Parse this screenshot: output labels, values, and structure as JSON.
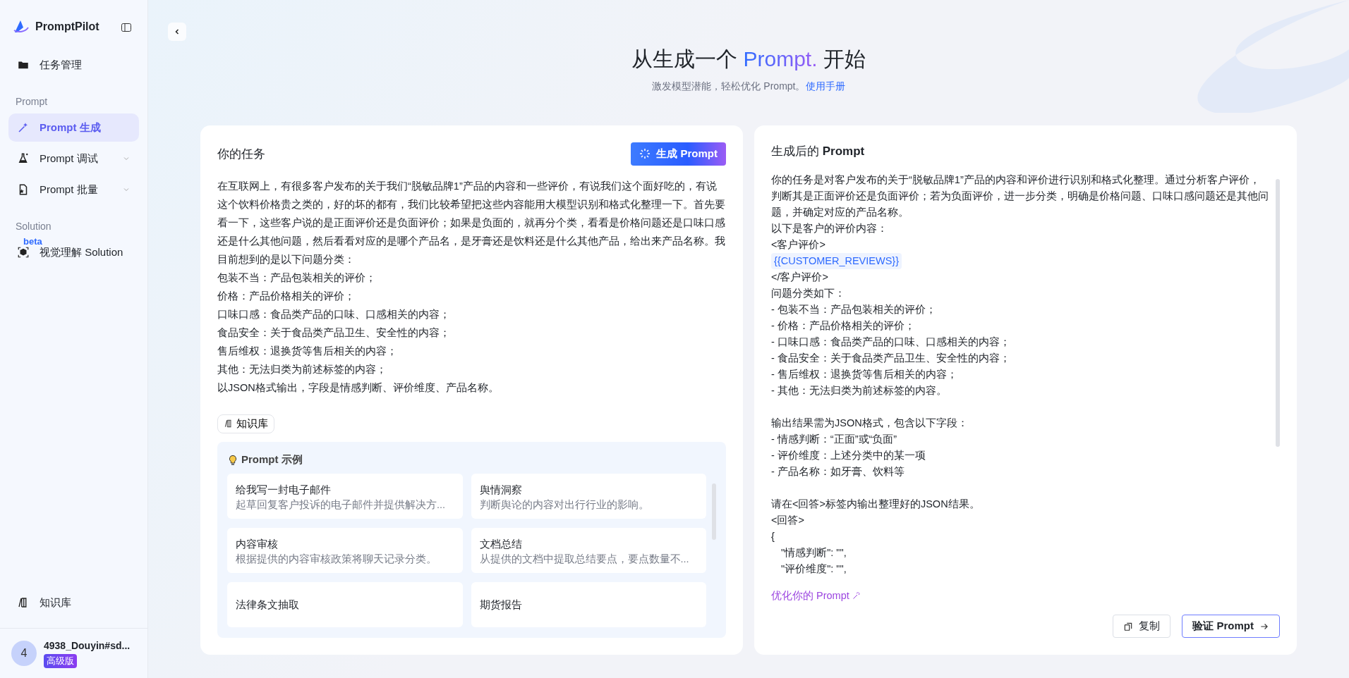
{
  "sidebar": {
    "brand": "PromptPilot",
    "items": [
      {
        "kind": "nav",
        "label": "任务管理",
        "selected": false
      },
      {
        "kind": "section",
        "label": "Prompt"
      },
      {
        "kind": "nav",
        "label": "Prompt 生成",
        "selected": true
      },
      {
        "kind": "nav",
        "label": "Prompt 调试",
        "selected": false,
        "expanded": false
      },
      {
        "kind": "nav",
        "label": "Prompt 批量",
        "selected": false,
        "expanded": false
      },
      {
        "kind": "section",
        "label": "Solution"
      },
      {
        "kind": "nav",
        "label": "视觉理解 Solution",
        "selected": false,
        "badge": "beta"
      }
    ],
    "bottom_item": {
      "label": "知识库"
    },
    "user": {
      "avatar": "4",
      "name": "4938_Douyin#sd...",
      "plan": "高级版"
    }
  },
  "header": {
    "title_start": "从生成一个 ",
    "title_highlight": "Prompt.",
    "title_end": " 开始",
    "subtitle": "激发模型潜能，轻松优化 Prompt。",
    "manual_link": "使用手册"
  },
  "task_card": {
    "title": "你的任务",
    "generate_button": "生成 Prompt",
    "lines": [
      "在互联网上，有很多客户发布的关于我们“脱敏品牌1”产品的内容和一些评价，有说我们这个面好吃的，有说这个饮料价格贵之类的，好的坏的都有，我们比较希望把这些内容能用大模型识别和格式化整理一下。首先要看一下，这些客户说的是正面评价还是负面评价；如果是负面的，就再分个类，看看是价格问题还是口味口感还是什么其他问题，然后看看对应的是哪个产品名，是牙膏还是饮料还是什么其他产品，给出来产品名称。我目前想到的是以下问题分类：",
      "包装不当：产品包装相关的评价；",
      "价格：产品价格相关的评价；",
      "口味口感：食品类产品的口味、口感相关的内容；",
      "食品安全：关于食品类产品卫生、安全性的内容；",
      "售后维权：退换货等售后相关的内容；",
      "其他：无法归类为前述标签的内容；",
      "以JSON格式输出，字段是情感判断、评价维度、产品名称。"
    ],
    "knowledge_chip": "知识库",
    "examples_title": "Prompt 示例",
    "examples": [
      {
        "title": "给我写一封电子邮件",
        "desc": "起草回复客户投诉的电子邮件并提供解决方..."
      },
      {
        "title": "舆情洞察",
        "desc": "判断舆论的内容对出行行业的影响。"
      },
      {
        "title": "内容审核",
        "desc": "根据提供的内容审核政策将聊天记录分类。"
      },
      {
        "title": "文档总结",
        "desc": "从提供的文档中提取总结要点，要点数量不..."
      },
      {
        "title": "法律条文抽取"
      },
      {
        "title": "期货报告"
      }
    ]
  },
  "result_card": {
    "title_start": "生成后的 ",
    "title_bold": "Prompt",
    "blocks": [
      [
        {
          "kind": "text",
          "text": "你的任务是对客户发布的关于“脱敏品牌1”产品的内容和评价进行识别和格式化整理。通过分析客户评价，判断其是正面评价还是负面评价；若为负面评价，进一步分类，明确是价格问题、口味口感问题还是其他问题，并确定对应的产品名称。"
        },
        {
          "kind": "text",
          "text": "以下是客户的评价内容："
        },
        {
          "kind": "text",
          "text": "<客户评价>"
        },
        {
          "kind": "variable",
          "text": "{{CUSTOMER_REVIEWS}}"
        },
        {
          "kind": "text",
          "text": "</客户评价>"
        },
        {
          "kind": "text",
          "text": "问题分类如下："
        },
        {
          "kind": "text",
          "text": "- 包装不当：产品包装相关的评价；"
        },
        {
          "kind": "text",
          "text": "- 价格：产品价格相关的评价；"
        },
        {
          "kind": "text",
          "text": "- 口味口感：食品类产品的口味、口感相关的内容；"
        },
        {
          "kind": "text",
          "text": "- 食品安全：关于食品类产品卫生、安全性的内容；"
        },
        {
          "kind": "text",
          "text": "- 售后维权：退换货等售后相关的内容；"
        },
        {
          "kind": "text",
          "text": "- 其他：无法归类为前述标签的内容。"
        }
      ],
      [
        {
          "kind": "text",
          "text": "输出结果需为JSON格式，包含以下字段："
        },
        {
          "kind": "text",
          "text": "- 情感判断：“正面”或“负面”"
        },
        {
          "kind": "text",
          "text": "- 评价维度：上述分类中的某一项"
        },
        {
          "kind": "text",
          "text": "- 产品名称：如牙膏、饮料等"
        }
      ],
      [
        {
          "kind": "text",
          "text": "请在<回答>标签内输出整理好的JSON结果。"
        },
        {
          "kind": "text",
          "text": "<回答>"
        },
        {
          "kind": "text",
          "text": "{"
        },
        {
          "kind": "indented",
          "text": "\"情感判断\": \"\","
        },
        {
          "kind": "indented",
          "text": "\"评价维度\": \"\","
        }
      ]
    ],
    "optimize_link": "优化你的 Prompt",
    "copy_button": "复制",
    "verify_button": "验证 Prompt"
  }
}
